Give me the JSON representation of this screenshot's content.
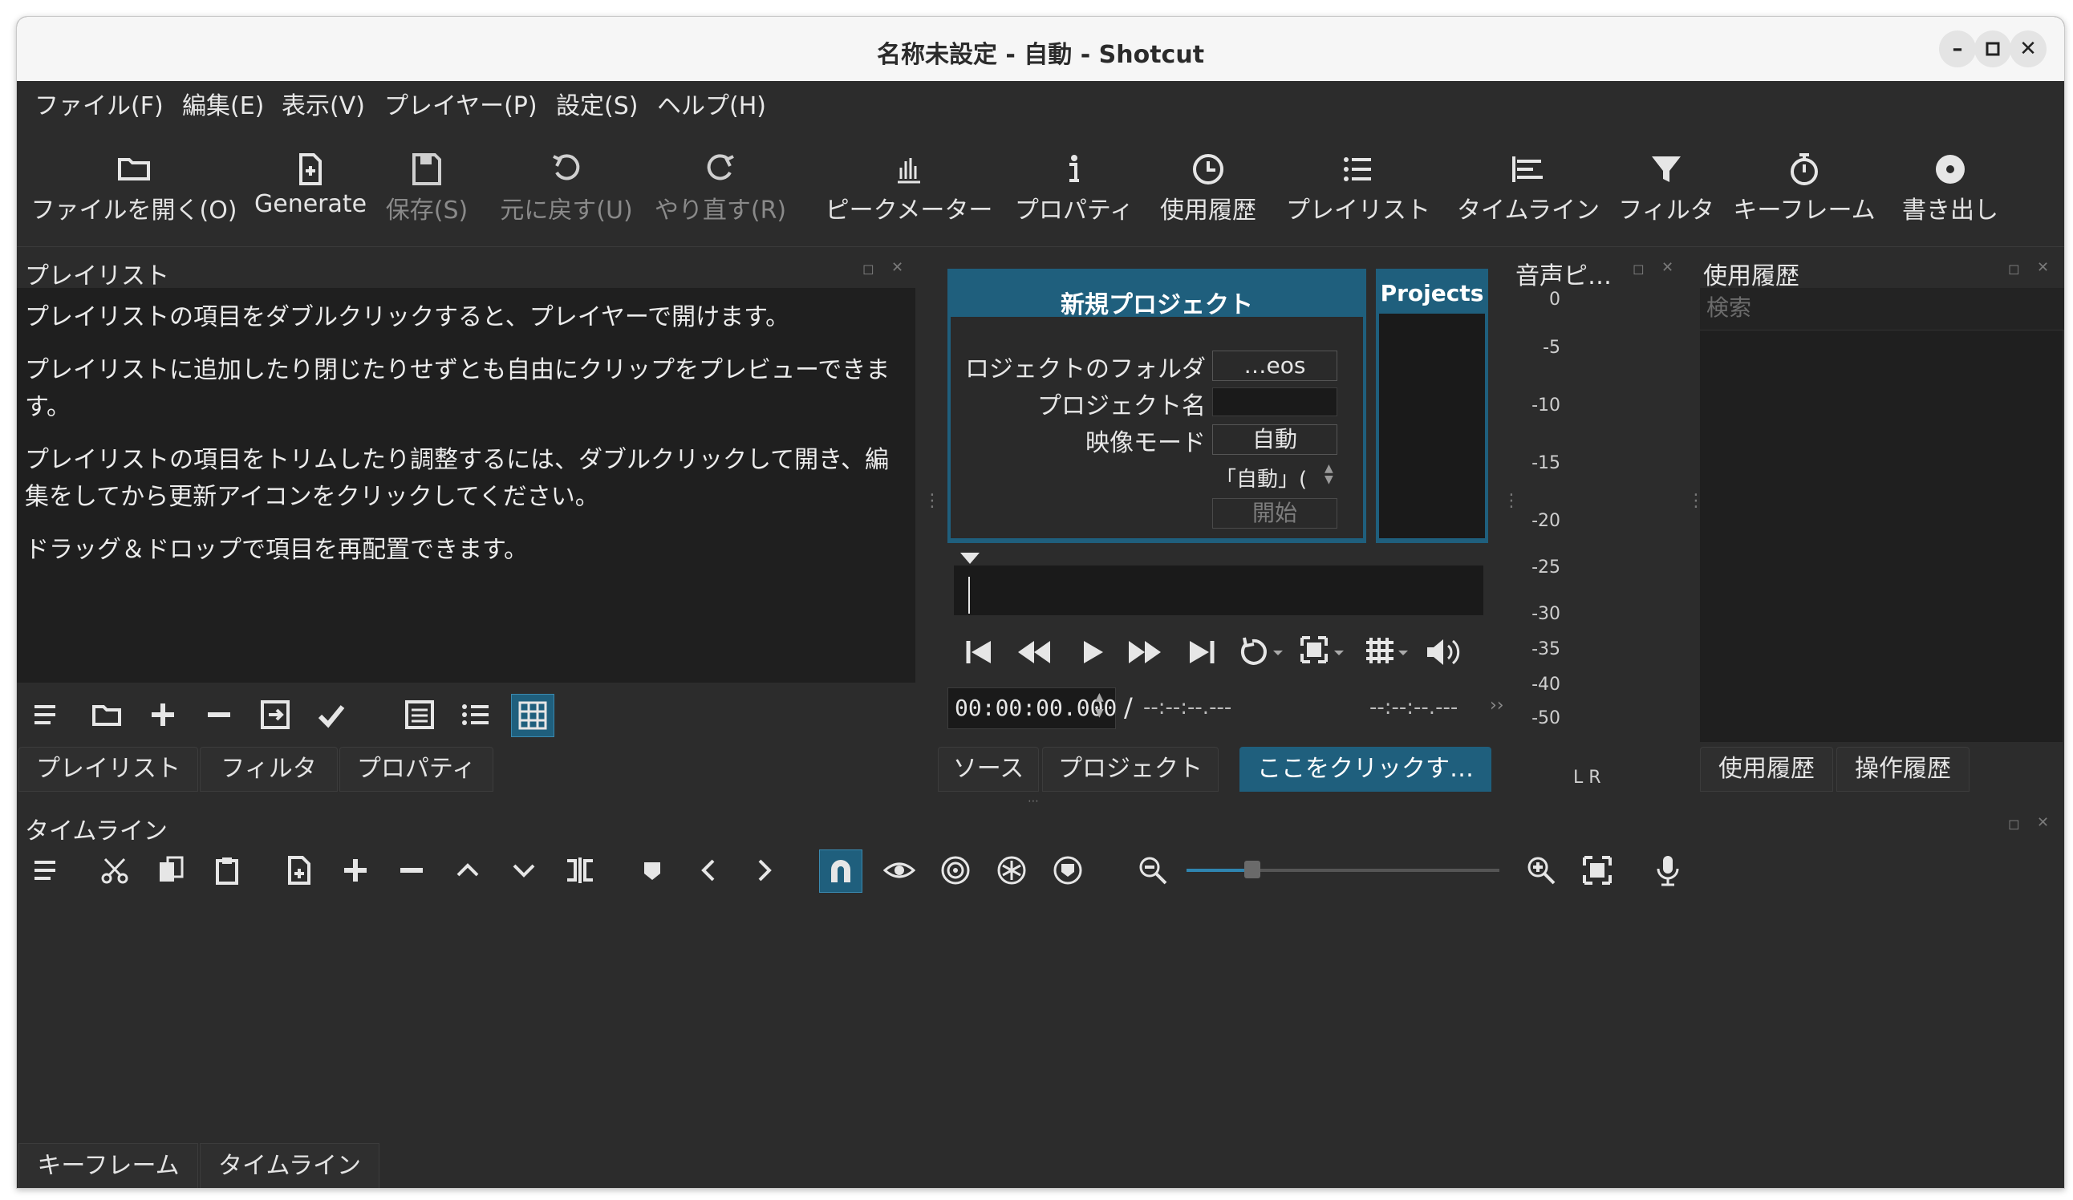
{
  "window": {
    "title": "名称未設定 - 自動 - Shotcut",
    "minimize": "–",
    "maximize": "□",
    "close": "✕"
  },
  "menu": [
    "ファイル(F)",
    "編集(E)",
    "表示(V)",
    "プレイヤー(P)",
    "設定(S)",
    "ヘルプ(H)"
  ],
  "toolbar": {
    "open": "ファイルを開く(O)",
    "generate": "Generate",
    "save": "保存(S)",
    "undo": "元に戻す(U)",
    "redo": "やり直す(R)",
    "peak": "ピークメーター",
    "properties": "プロパティ",
    "history": "使用履歴",
    "playlist": "プレイリスト",
    "timeline": "タイムライン",
    "filters": "フィルタ",
    "keyframes": "キーフレーム",
    "export": "書き出し"
  },
  "playlist": {
    "title": "プレイリスト",
    "help": [
      "プレイリストの項目をダブルクリックすると、プレイヤーで開けます。",
      "プレイリストに追加したり閉じたりせずとも自由にクリップをプレビューできます。",
      "プレイリストの項目をトリムしたり調整するには、ダブルクリックして開き、編集をしてから更新アイコンをクリックしてください。",
      "ドラッグ＆ドロップで項目を再配置できます。"
    ],
    "tabs": [
      "プレイリスト",
      "フィルタ",
      "プロパティ"
    ]
  },
  "new_project": {
    "heading": "新規プロジェクト",
    "folder_label": "ロジェクトのフォルダ",
    "folder_value": "…eos",
    "name_label": "プロジェクト名",
    "name_value": "",
    "mode_label": "映像モード",
    "mode_value": "自動",
    "auto_note": "「自動」(",
    "start": "開始",
    "projects_heading": "Projects"
  },
  "player": {
    "timecode": "00:00:00.000",
    "separator": "/",
    "duration": "--:--:--.---",
    "remaining": "--:--:--.---",
    "tabs": [
      "ソース",
      "プロジェクト",
      "ここをクリックす…"
    ]
  },
  "audio": {
    "title": "音声ピ…",
    "scale": [
      "0",
      "-5",
      "-10",
      "-15",
      "-20",
      "-25",
      "-30",
      "-35",
      "-40",
      "-50"
    ],
    "channels": "L  R"
  },
  "recent": {
    "title": "使用履歴",
    "search_placeholder": "検索",
    "tabs": [
      "使用履歴",
      "操作履歴"
    ]
  },
  "timeline": {
    "title": "タイムライン",
    "zoom_level": 0.5
  },
  "bottom_tabs": [
    "キーフレーム",
    "タイムライン"
  ],
  "colors": {
    "accent": "#1f5f7d",
    "window_bg": "#2c2c2c",
    "panel_bg": "#1f1f1f"
  }
}
